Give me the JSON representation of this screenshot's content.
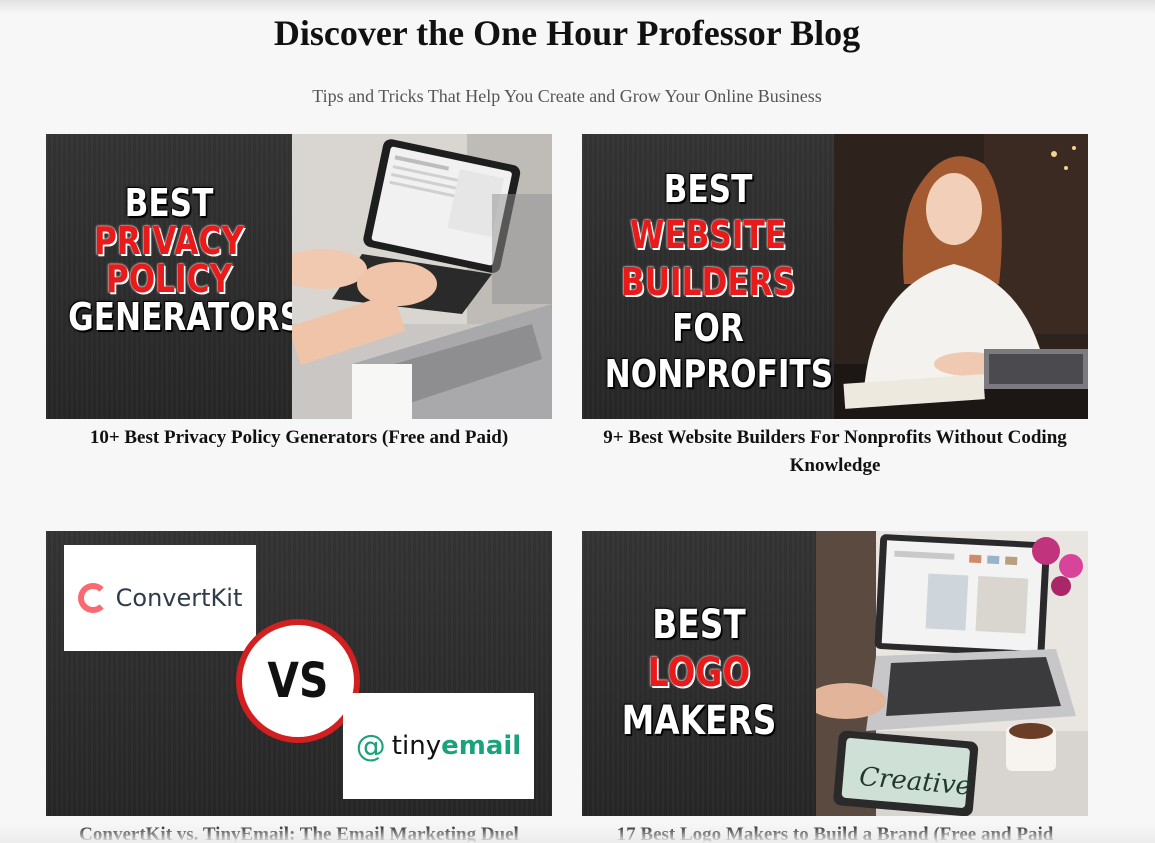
{
  "header": {
    "title": "Discover the One Hour Professor Blog",
    "subtitle": "Tips and Tricks That Help You Create and Grow Your Online Business"
  },
  "posts": [
    {
      "title": "10+ Best Privacy Policy Generators (Free and Paid)",
      "image_text": [
        "BEST",
        "PRIVACY",
        "POLICY",
        "GENERATORS"
      ]
    },
    {
      "title": "9+ Best Website Builders For Nonprofits Without Coding Knowledge",
      "image_text": [
        "BEST",
        "WEBSITE",
        "BUILDERS",
        "FOR",
        "NONPROFITS"
      ]
    },
    {
      "title": "ConvertKit vs. TinyEmail: The Email Marketing Duel",
      "image_text": [
        "ConvertKit",
        "VS",
        "tiny",
        "email"
      ]
    },
    {
      "title": "17 Best Logo Makers to Build a Brand (Free and Paid",
      "image_text": [
        "BEST",
        "LOGO",
        "MAKERS",
        "Creative"
      ]
    }
  ],
  "colors": {
    "background": "#f7f7f7",
    "thumbnail_dark": "#2b2b2b",
    "accent_red": "#e81a1a",
    "convertkit_red": "#fb6970",
    "tinyemail_green": "#1aa37a"
  }
}
